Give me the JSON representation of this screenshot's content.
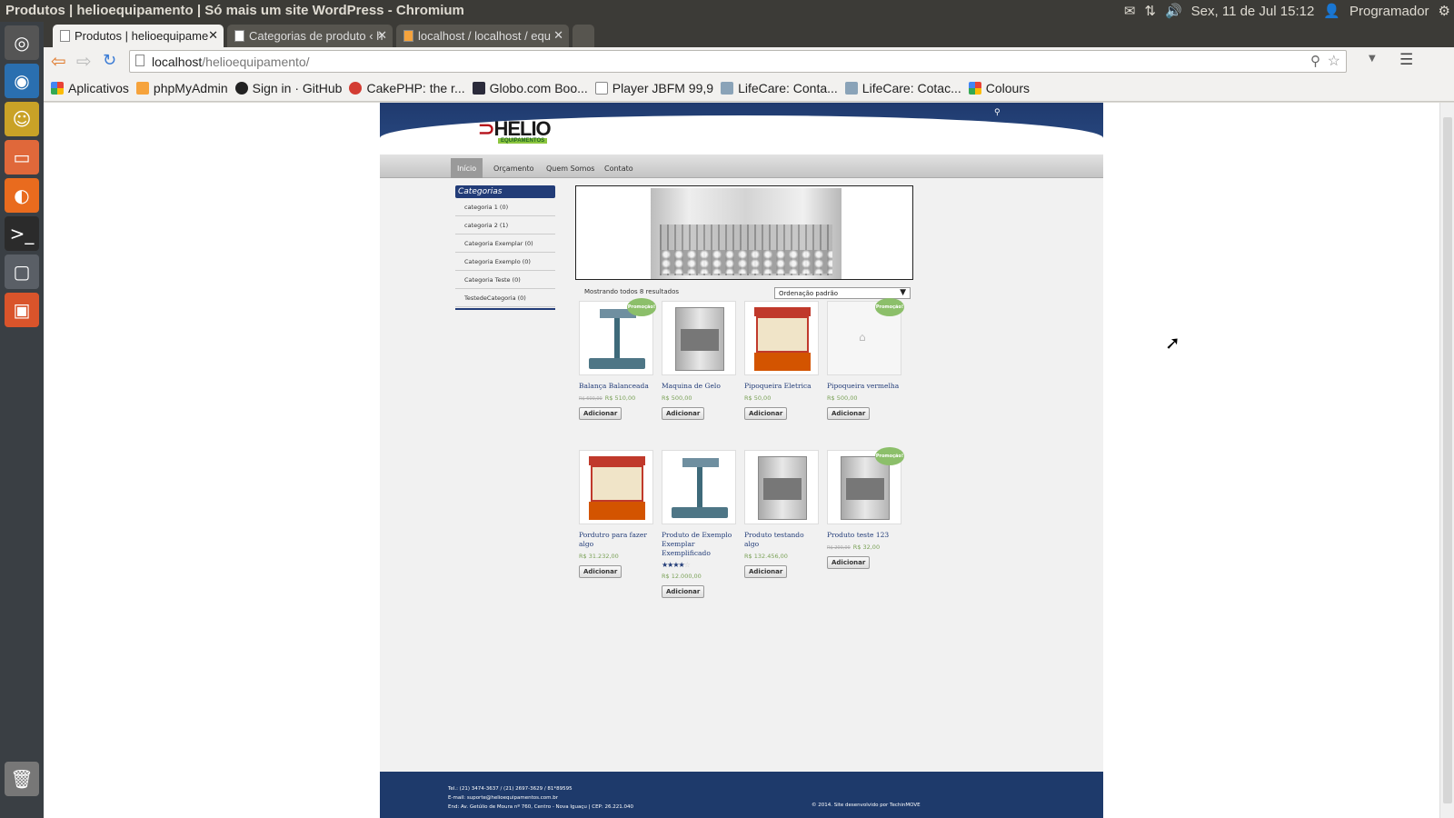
{
  "window_title": "Produtos | helioequipamento | Só mais um site WordPress - Chromium",
  "top_panel": {
    "date": "Sex, 11 de Jul 15:12",
    "user": "Programador"
  },
  "tabs": [
    {
      "label": "Produtos | helioequipame",
      "active": true
    },
    {
      "label": "Categorias de produto ‹ h",
      "active": false
    },
    {
      "label": "localhost / localhost / equ",
      "active": false
    }
  ],
  "address": {
    "host": "localhost",
    "path": "/helioequipamento/"
  },
  "bookmarks": [
    "Aplicativos",
    "phpMyAdmin",
    "Sign in · GitHub",
    "CakePHP: the r...",
    "Globo.com Boo...",
    "Player JBFM 99,9",
    "LifeCare: Conta...",
    "LifeCare: Cotac...",
    "Colours"
  ],
  "site": {
    "logo": "HELIO",
    "logo_sub": "EQUIPAMENTOS",
    "nav": [
      "Início",
      "Orçamento",
      "Quem Somos",
      "Contato"
    ],
    "sidebar_title": "Categorias",
    "categories": [
      "categoria 1 (0)",
      "categoria 2 (1)",
      "Categoria Exemplar (0)",
      "Categoria Exemplo (0)",
      "Categoria Teste (0)",
      "TestedeCategoria (0)"
    ],
    "results": "Mostrando todos 8 resultados",
    "ordering": "Ordenação padrão",
    "badge": "Promoção!",
    "button": "Adicionar",
    "products": [
      {
        "name": "Balança Balanceada",
        "old_price": "R$ 600,00",
        "price": "R$ 510,00"
      },
      {
        "name": "Maquina de Gelo",
        "price": "R$ 500,00"
      },
      {
        "name": "Pipoqueira Eletrica",
        "price": "R$ 50,00"
      },
      {
        "name": "Pipoqueira vermelha",
        "price": "R$ 500,00"
      },
      {
        "name": "Pordutro para fazer algo",
        "price": "R$ 31.232,00"
      },
      {
        "name": "Produto de Exemplo Exemplar Exemplificado",
        "stars": "★★★★",
        "rating_suffix": "☆",
        "price": "R$ 12.000,00"
      },
      {
        "name": "Produto testando algo",
        "price": "R$ 132.456,00"
      },
      {
        "name": "Produto teste 123",
        "old_price": "R$ 200,00",
        "price": "R$ 32,00"
      }
    ],
    "footer": {
      "tel": "Tel.: (21) 3474-3637 / (21) 2697-3629 / 81*89595",
      "email": "E-mail: suporte@helioequipamentos.com.br",
      "address": "End: Av. Getúlio de Moura nº 760, Centro - Nova Iguaçu | CEP: 26.221.040",
      "copyright": "© 2014. Site desenvolvido por TechinMOVE"
    }
  }
}
